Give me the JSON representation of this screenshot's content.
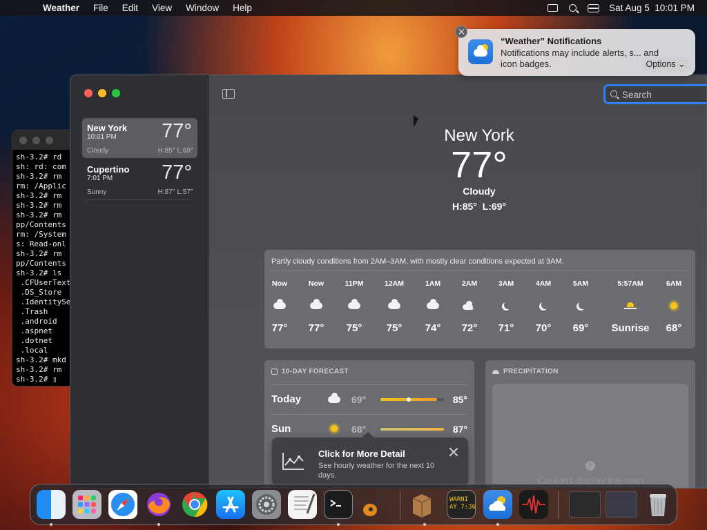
{
  "menubar": {
    "app_name": "Weather",
    "menus": [
      "File",
      "Edit",
      "View",
      "Window",
      "Help"
    ],
    "datetime": "Sat Aug 5  10:01 PM"
  },
  "notification": {
    "title": "“Weather” Notifications",
    "body": "Notifications may include alerts, s... and icon badges.",
    "options_label": "Options ⌄"
  },
  "terminal": {
    "lines": [
      "sh-3.2# rd",
      "sh: rd: com",
      "sh-3.2# rm",
      "rm: /Applic",
      "sh-3.2# rm",
      "sh-3.2# rm",
      "sh-3.2# rm",
      "pp/Contents",
      "rm: /System",
      "s: Read-onl",
      "sh-3.2# rm",
      "pp/Contents",
      "sh-3.2# ls",
      " .CFUserText",
      " .DS_Store",
      " .IdentitySe",
      " .Trash",
      " .android",
      " .aspnet",
      " .dotnet",
      " .local",
      "sh-3.2# mkd",
      "sh-3.2# rm",
      "sh-3.2# ▯"
    ]
  },
  "sidebar": {
    "locations": [
      {
        "name": "New York",
        "time": "10:01 PM",
        "temp": "77°",
        "condition": "Cloudy",
        "hilo": "H:85°  L:69°"
      },
      {
        "name": "Cupertino",
        "time": "7:01 PM",
        "temp": "77°",
        "condition": "Sunny",
        "hilo": "H:87°  L:57°"
      }
    ]
  },
  "search": {
    "placeholder": "Search"
  },
  "current": {
    "city": "New York",
    "temp": "77°",
    "condition": "Cloudy",
    "hilo": "H:85°  L:69°"
  },
  "hourly": {
    "summary": "Partly cloudy conditions from 2AM–3AM, with mostly clear conditions expected at 3AM.",
    "items": [
      {
        "hour": "Now",
        "icon": "cloud-icon",
        "temp": "77°"
      },
      {
        "hour": "Now",
        "icon": "cloud-icon",
        "temp": "77°"
      },
      {
        "hour": "11PM",
        "icon": "cloud-icon",
        "temp": "75°"
      },
      {
        "hour": "12AM",
        "icon": "cloud-icon",
        "temp": "75°"
      },
      {
        "hour": "1AM",
        "icon": "cloud-icon",
        "temp": "74°"
      },
      {
        "hour": "2AM",
        "icon": "partly-cloudy-night-icon",
        "temp": "72°"
      },
      {
        "hour": "3AM",
        "icon": "moon-icon",
        "temp": "71°"
      },
      {
        "hour": "4AM",
        "icon": "moon-icon",
        "temp": "70°"
      },
      {
        "hour": "5AM",
        "icon": "moon-icon",
        "temp": "69°"
      },
      {
        "hour": "5:57AM",
        "icon": "sunrise-icon",
        "temp": "Sunrise"
      },
      {
        "hour": "6AM",
        "icon": "sun-icon",
        "temp": "68°"
      }
    ]
  },
  "forecast": {
    "title": "10-DAY FORECAST",
    "days": [
      {
        "day": "Today",
        "icon": "cloud-icon",
        "low": "69°",
        "high": "85°"
      },
      {
        "day": "Sun",
        "icon": "sun-icon",
        "low": "68°",
        "high": "87°"
      }
    ]
  },
  "popover": {
    "title": "Click for More Detail",
    "desc": "See hourly weather for the next 10 days."
  },
  "precipitation": {
    "title": "PRECIPITATION",
    "message": "Couldn't display the map"
  },
  "dock": {
    "apps": [
      "finder-icon",
      "launchpad-icon",
      "safari-icon",
      "firefox-icon",
      "chrome-icon",
      "app-store-icon",
      "system-settings-icon",
      "textedit-icon",
      "terminal-icon",
      "garageband-icon",
      "archive-utility-icon",
      "console-icon",
      "weather-icon",
      "audio-app-icon",
      "window-thumbnail-icon",
      "window-thumbnail-icon",
      "trash-icon"
    ],
    "console_text": "WARNI\nAY 7:36"
  }
}
